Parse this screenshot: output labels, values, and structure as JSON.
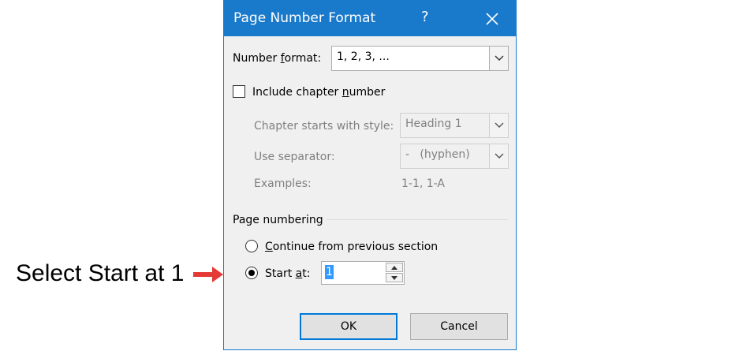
{
  "callout": {
    "text": "Select Start at 1",
    "arrow_color": "#e53935"
  },
  "dialog": {
    "title": "Page Number Format",
    "help_label": "?",
    "accent_color": "#1979ca",
    "number_format": {
      "label_pre": "Number ",
      "label_ul": "f",
      "label_post": "ormat:",
      "value": "1, 2, 3, ..."
    },
    "include_chapter": {
      "label_pre": "Include chapter ",
      "label_ul": "n",
      "label_post": "umber",
      "checked": false
    },
    "chapter_style": {
      "label": "Chapter starts with style:",
      "value": "Heading 1"
    },
    "separator": {
      "label": "Use separator:",
      "value": "-   (hyphen)"
    },
    "examples": {
      "label": "Examples:",
      "value": "1-1, 1-A"
    },
    "page_numbering": {
      "heading": "Page numbering",
      "continue_label_ul": "C",
      "continue_label_post": "ontinue from previous section",
      "start_at_label_pre": "Start ",
      "start_at_label_ul": "a",
      "start_at_label_post": "t:",
      "start_at_value": "1",
      "selected": "start_at"
    },
    "ok_label": "OK",
    "cancel_label": "Cancel"
  }
}
